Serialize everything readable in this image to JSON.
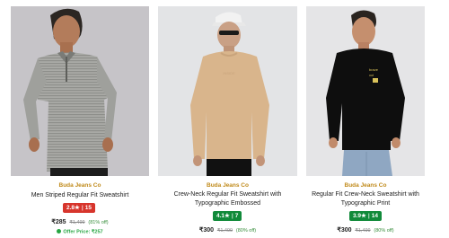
{
  "products": [
    {
      "brand": "Buda Jeans Co",
      "title": "Men Striped Regular Fit Sweatshirt",
      "title_line2": "",
      "rating": "2.8★",
      "reviews": "15",
      "price": "₹285",
      "mrp": "₹1,499",
      "discount": "(81% off)",
      "offer_price": "Offer Price: ₹257",
      "rating_color": "#d7352c"
    },
    {
      "brand": "Buda Jeans Co",
      "title": "Crew-Neck Regular Fit Sweatshirt with",
      "title_line2": "Typographic Embossed",
      "rating": "4.1★",
      "reviews": "7",
      "price": "₹300",
      "mrp": "₹1,499",
      "discount": "(80% off)",
      "rating_color": "#118a3a"
    },
    {
      "brand": "Buda Jeans Co",
      "title": "Regular Fit Crew-Neck Sweatshirt with",
      "title_line2": "Typographic Print",
      "rating": "3.9★",
      "reviews": "14",
      "price": "₹300",
      "mrp": "₹1,499",
      "discount": "(80% off)",
      "rating_color": "#118a3a"
    }
  ]
}
